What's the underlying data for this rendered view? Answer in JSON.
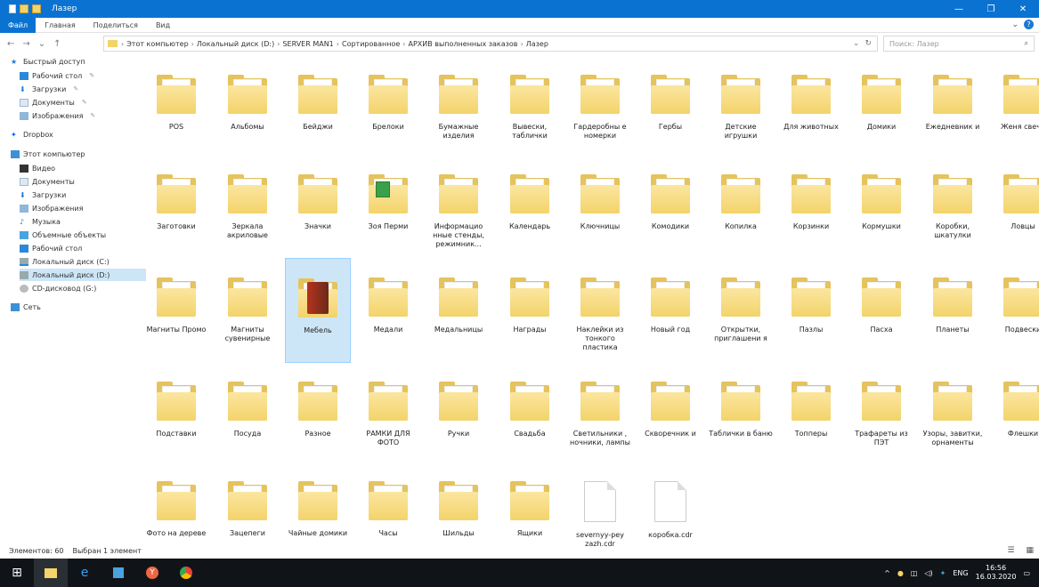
{
  "window": {
    "title": "Лазер"
  },
  "ribbon": {
    "file": "Файл",
    "tabs": [
      "Главная",
      "Поделиться",
      "Вид"
    ]
  },
  "address": {
    "crumbs": [
      "Этот компьютер",
      "Локальный диск (D:)",
      "SERVER MAN1",
      "Сортированное",
      "АРХИВ выполненных заказов",
      "Лазер"
    ],
    "refresh_label": "↻",
    "search_placeholder": "Поиск: Лазер"
  },
  "sidebar": {
    "items": [
      {
        "label": "Быстрый доступ",
        "pin": ""
      },
      {
        "label": "Рабочий стол",
        "pin": "✎"
      },
      {
        "label": "Загрузки",
        "pin": "✎"
      },
      {
        "label": "Документы",
        "pin": "✎"
      },
      {
        "label": "Изображения",
        "pin": "✎"
      },
      {
        "label": "Dropbox",
        "pin": ""
      },
      {
        "label": "Этот компьютер",
        "pin": ""
      },
      {
        "label": "Видео",
        "pin": ""
      },
      {
        "label": "Документы",
        "pin": ""
      },
      {
        "label": "Загрузки",
        "pin": ""
      },
      {
        "label": "Изображения",
        "pin": ""
      },
      {
        "label": "Музыка",
        "pin": ""
      },
      {
        "label": "Объемные объекты",
        "pin": ""
      },
      {
        "label": "Рабочий стол",
        "pin": ""
      },
      {
        "label": "Локальный диск (C:)",
        "pin": ""
      },
      {
        "label": "Локальный диск (D:)",
        "pin": ""
      },
      {
        "label": "CD-дисковод (G:)",
        "pin": ""
      },
      {
        "label": "Сеть",
        "pin": ""
      }
    ]
  },
  "items": [
    {
      "label": "POS",
      "kind": "folder"
    },
    {
      "label": "Альбомы",
      "kind": "folder"
    },
    {
      "label": "Бейджи",
      "kind": "folder"
    },
    {
      "label": "Брелоки",
      "kind": "folder"
    },
    {
      "label": "Бумажные изделия",
      "kind": "folder"
    },
    {
      "label": "Вывески, таблички",
      "kind": "folder"
    },
    {
      "label": "Гардеробны е номерки",
      "kind": "folder"
    },
    {
      "label": "Гербы",
      "kind": "folder"
    },
    {
      "label": "Детские игрушки",
      "kind": "folder"
    },
    {
      "label": "Для животных",
      "kind": "folder"
    },
    {
      "label": "Домики",
      "kind": "folder"
    },
    {
      "label": "Ежедневник и",
      "kind": "folder"
    },
    {
      "label": "Женя свечи",
      "kind": "folder"
    },
    {
      "label": "Заготовки",
      "kind": "folder"
    },
    {
      "label": "Зеркала акриловые",
      "kind": "folder"
    },
    {
      "label": "Значки",
      "kind": "folder"
    },
    {
      "label": "Зоя Перми",
      "kind": "folder-green"
    },
    {
      "label": "Информацио нные стенды, режимник...",
      "kind": "folder"
    },
    {
      "label": "Календарь",
      "kind": "folder"
    },
    {
      "label": "Ключницы",
      "kind": "folder"
    },
    {
      "label": "Комодики",
      "kind": "folder"
    },
    {
      "label": "Копилка",
      "kind": "folder"
    },
    {
      "label": "Корзинки",
      "kind": "folder"
    },
    {
      "label": "Кормушки",
      "kind": "folder"
    },
    {
      "label": "Коробки, шкатулки",
      "kind": "folder"
    },
    {
      "label": "Ловцы",
      "kind": "folder"
    },
    {
      "label": "Магниты Промо",
      "kind": "folder"
    },
    {
      "label": "Магниты сувенирные",
      "kind": "folder"
    },
    {
      "label": "Мебель",
      "kind": "folder-red",
      "selected": true
    },
    {
      "label": "Медали",
      "kind": "folder"
    },
    {
      "label": "Медальницы",
      "kind": "folder"
    },
    {
      "label": "Награды",
      "kind": "folder"
    },
    {
      "label": "Наклейки из тонкого пластика",
      "kind": "folder"
    },
    {
      "label": "Новый год",
      "kind": "folder"
    },
    {
      "label": "Открытки, приглашени я",
      "kind": "folder"
    },
    {
      "label": "Пазлы",
      "kind": "folder"
    },
    {
      "label": "Пасха",
      "kind": "folder"
    },
    {
      "label": "Планеты",
      "kind": "folder"
    },
    {
      "label": "Подвески",
      "kind": "folder"
    },
    {
      "label": "Подставки",
      "kind": "folder"
    },
    {
      "label": "Посуда",
      "kind": "folder"
    },
    {
      "label": "Разное",
      "kind": "folder"
    },
    {
      "label": "РАМКИ ДЛЯ ФОТО",
      "kind": "folder"
    },
    {
      "label": "Ручки",
      "kind": "folder"
    },
    {
      "label": "Свадьба",
      "kind": "folder"
    },
    {
      "label": "Светильники , ночники, лампы",
      "kind": "folder"
    },
    {
      "label": "Скворечник и",
      "kind": "folder"
    },
    {
      "label": "Таблички в баню",
      "kind": "folder"
    },
    {
      "label": "Топперы",
      "kind": "folder"
    },
    {
      "label": "Трафареты из ПЭТ",
      "kind": "folder"
    },
    {
      "label": "Узоры, завитки, орнаменты",
      "kind": "folder"
    },
    {
      "label": "Флешки",
      "kind": "folder"
    },
    {
      "label": "Фото на дереве",
      "kind": "folder"
    },
    {
      "label": "Зацепеги",
      "kind": "folder"
    },
    {
      "label": "Чайные домики",
      "kind": "folder"
    },
    {
      "label": "Часы",
      "kind": "folder"
    },
    {
      "label": "Шильды",
      "kind": "folder"
    },
    {
      "label": "Ящики",
      "kind": "folder"
    },
    {
      "label": "severnyy-pey zazh.cdr",
      "kind": "file"
    },
    {
      "label": "коробка.cdr",
      "kind": "file"
    }
  ],
  "status": {
    "count": "Элементов: 60",
    "selected": "Выбран 1 элемент"
  },
  "tray": {
    "lang": "ENG",
    "time": "16:56",
    "date": "16.03.2020"
  },
  "colors": {
    "titlebar": "#0a73d2",
    "selection": "#cde6f7",
    "folder": "#f3d36a",
    "taskbar": "#101418"
  }
}
